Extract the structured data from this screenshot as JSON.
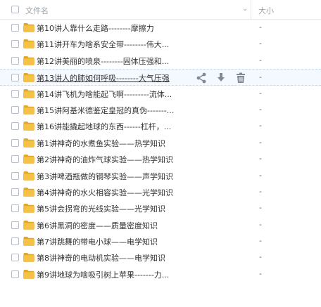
{
  "header": {
    "name_label": "文件名",
    "size_label": "大小",
    "sort_arrow": "⌄"
  },
  "files": [
    {
      "name": "第10讲人靠什么走路--------摩擦力",
      "size": "-"
    },
    {
      "name": "第11讲开车为啥系安全带--------伟大...",
      "size": "-"
    },
    {
      "name": "第12讲美丽的喷泉--------固体压强和...",
      "size": "-"
    },
    {
      "name": "第13讲人的肺如何呼吸--------大气压强",
      "size": "-"
    },
    {
      "name": "第14讲飞机为啥能起飞啊---------流体...",
      "size": "-"
    },
    {
      "name": "第15讲阿基米德鉴定皇冠的真伪-------...",
      "size": "-"
    },
    {
      "name": "第16讲能撬起地球的东西------杠杆，...",
      "size": "-"
    },
    {
      "name": "第1讲神奇的水煮鱼实验——热学知识",
      "size": "-"
    },
    {
      "name": "第2讲神奇的油炸气球实验——热学知识",
      "size": "-"
    },
    {
      "name": "第3讲啤酒瓶做的钢琴实验——声学知识",
      "size": "-"
    },
    {
      "name": "第4讲神奇的水火相容实验——光学知识",
      "size": "-"
    },
    {
      "name": "第5讲会拐弯的光线实验——光学知识",
      "size": "-"
    },
    {
      "name": "第6讲黑洞的密度——质量密度知识",
      "size": "-"
    },
    {
      "name": "第7讲跳舞的带电小球——电学知识",
      "size": "-"
    },
    {
      "name": "第8讲神奇的电动机实验——电学知识",
      "size": "-"
    },
    {
      "name": "第9讲地球为啥吸引树上苹果-------力...",
      "size": "-"
    }
  ],
  "hover_row_index": 3,
  "hover_actions": [
    "share-icon",
    "download-icon",
    "delete-icon"
  ],
  "colors": {
    "folder": "#f5c246",
    "folder_dark": "#e0a72a",
    "icon_gray": "#7f8a96",
    "hover_bg": "#f4f9ff"
  }
}
